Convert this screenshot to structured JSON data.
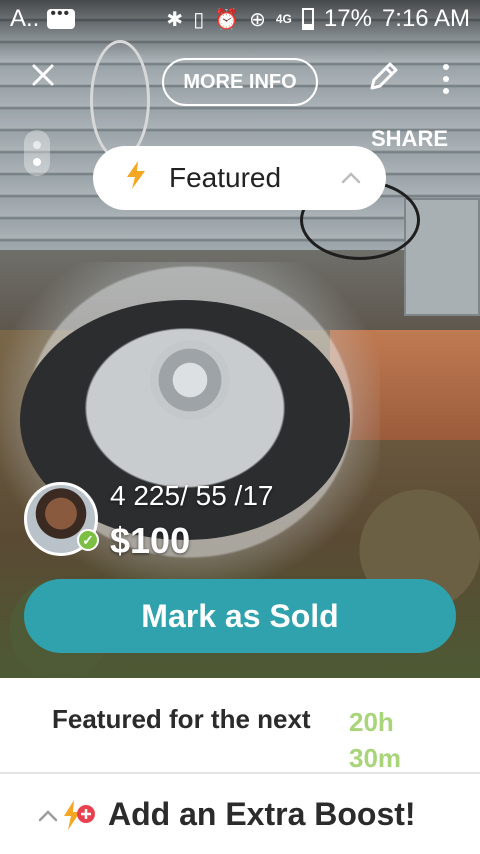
{
  "status_bar": {
    "app_letter": "A..",
    "battery": "17%",
    "time": "7:16 AM",
    "network": "4G"
  },
  "top_bar": {
    "more_info_label": "MORE INFO",
    "share_label": "SHARE"
  },
  "featured_pill": {
    "label": "Featured"
  },
  "listing": {
    "title": "4  225/ 55 /17",
    "price": "$100"
  },
  "actions": {
    "mark_sold_label": "Mark as Sold"
  },
  "featured_info": {
    "text": "Featured for the next",
    "timer_hours": "20h",
    "timer_minutes": "30m"
  },
  "boost": {
    "label": "Add an Extra Boost!"
  },
  "colors": {
    "accent_teal": "#2fa2ae",
    "timer_green": "#a8d47a",
    "bolt_orange": "#f5a623",
    "boost_red": "#e8404f"
  },
  "icons": [
    "close-icon",
    "pencil-icon",
    "more-vert-icon",
    "lightning-icon",
    "chevron-up-icon",
    "verified-check-icon",
    "boost-plus-icon"
  ]
}
